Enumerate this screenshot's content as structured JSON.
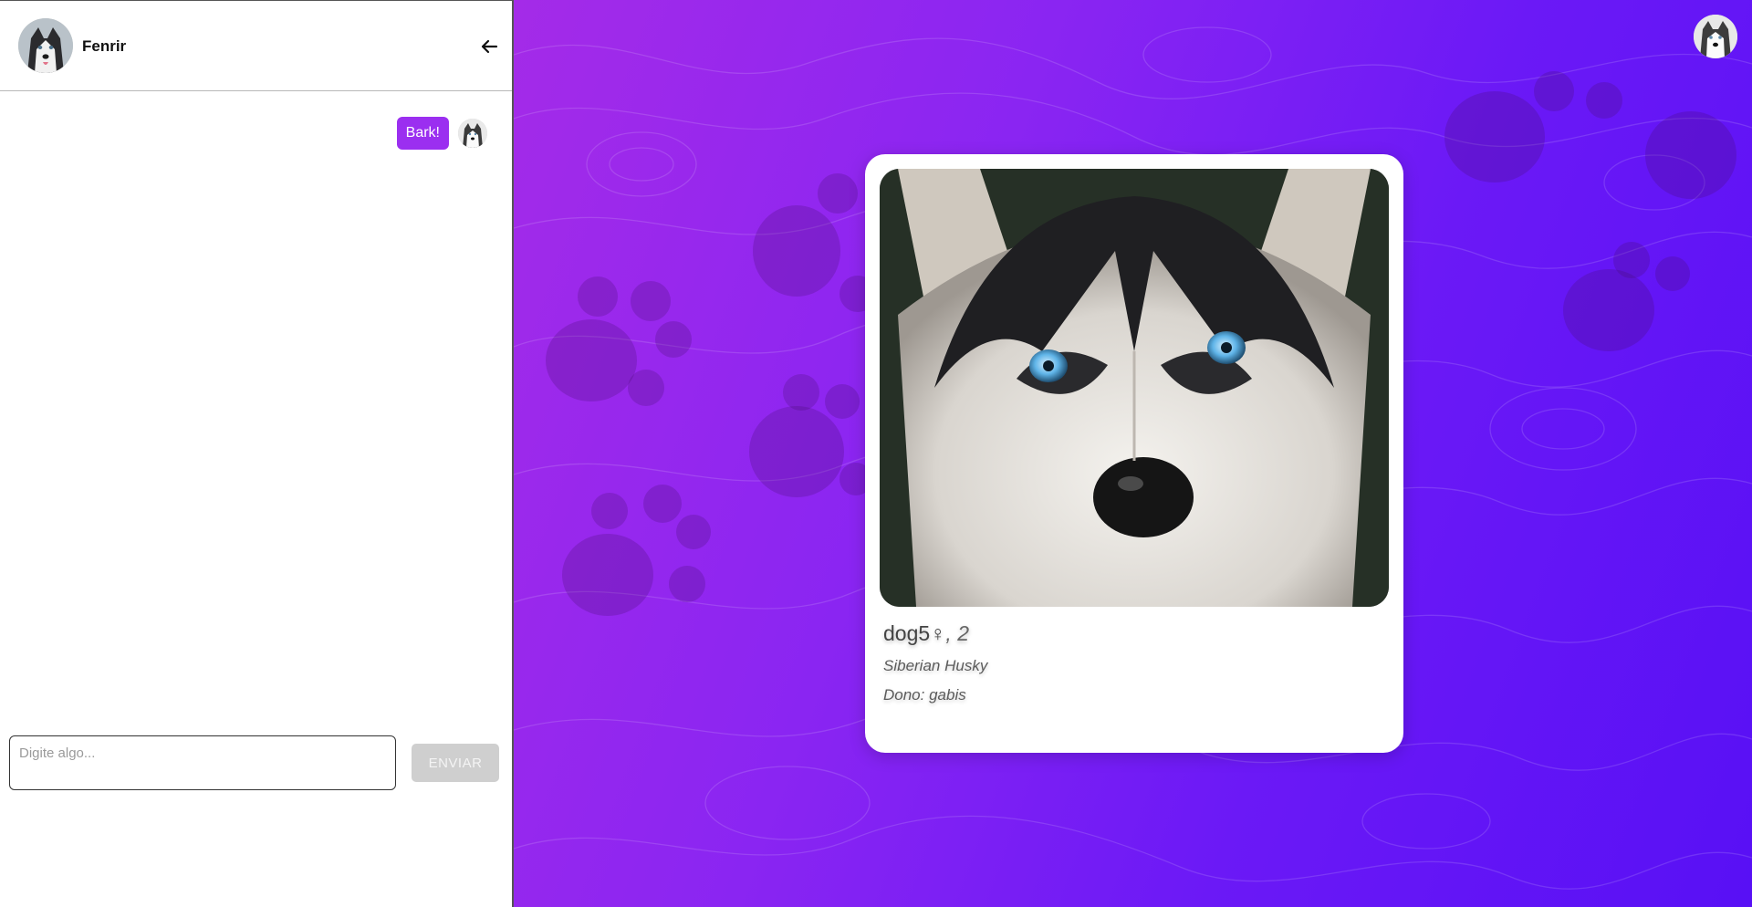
{
  "chat": {
    "contact_name": "Fenrir",
    "back_icon": "arrow-left-icon",
    "messages": [
      {
        "text": "Bark!",
        "from": "self"
      }
    ],
    "input_placeholder": "Digite algo...",
    "input_value": "",
    "send_label": "ENVIAR"
  },
  "profile": {
    "name": "dog5",
    "gender_symbol": "♀",
    "age_text": ", 2",
    "breed": "Siberian Husky",
    "owner": "Dono: gabis"
  },
  "colors": {
    "accent": "#9b2ff0",
    "background_start": "#a42be8",
    "background_end": "#5810f5",
    "send_disabled": "#cfcfcf"
  },
  "icons": {
    "back": "arrow-left-icon",
    "paw": "paw-icon"
  }
}
